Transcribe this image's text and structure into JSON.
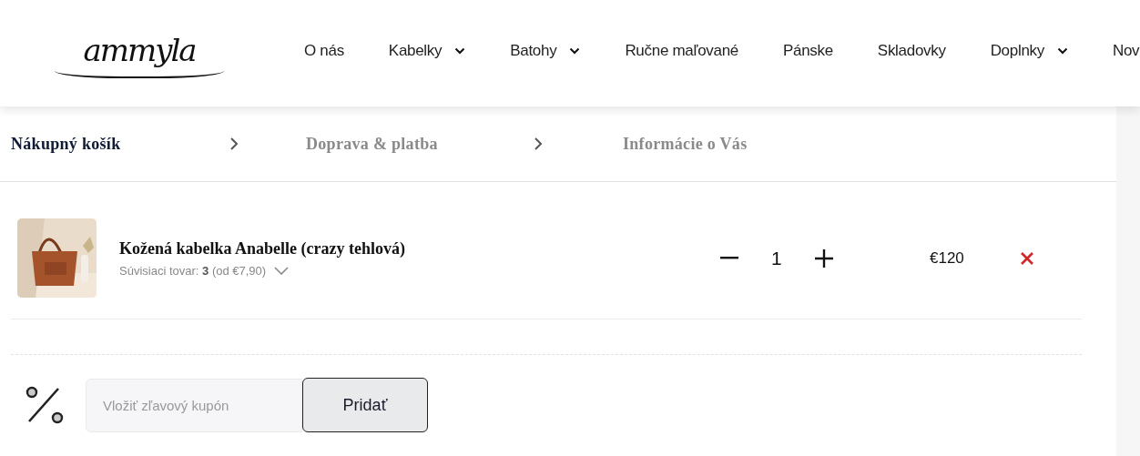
{
  "header": {
    "logo": "ammyla",
    "nav": [
      {
        "label": "O nás",
        "dropdown": false
      },
      {
        "label": "Kabelky",
        "dropdown": true
      },
      {
        "label": "Batohy",
        "dropdown": true
      },
      {
        "label": "Ručne maľované",
        "dropdown": false
      },
      {
        "label": "Pánske",
        "dropdown": false
      },
      {
        "label": "Skladovky",
        "dropdown": false
      },
      {
        "label": "Doplnky",
        "dropdown": true
      },
      {
        "label": "Nov",
        "dropdown": false
      }
    ]
  },
  "steps": [
    {
      "label": "Nákupný košík",
      "selected": true
    },
    {
      "label": "Doprava & platba",
      "selected": false
    },
    {
      "label": "Informácie o Vás",
      "selected": false
    }
  ],
  "cart": {
    "items": [
      {
        "kind": "picture",
        "name": "Kožená kabelka Anabelle (crazy tehlová)",
        "related": "Súvisiaci tovar: **3** (od €7,90)",
        "quantity": "1",
        "price": "€120"
      }
    ]
  },
  "coupon": {
    "placeholder": "Vložiť zľavový kupón",
    "button": "Pridať"
  }
}
